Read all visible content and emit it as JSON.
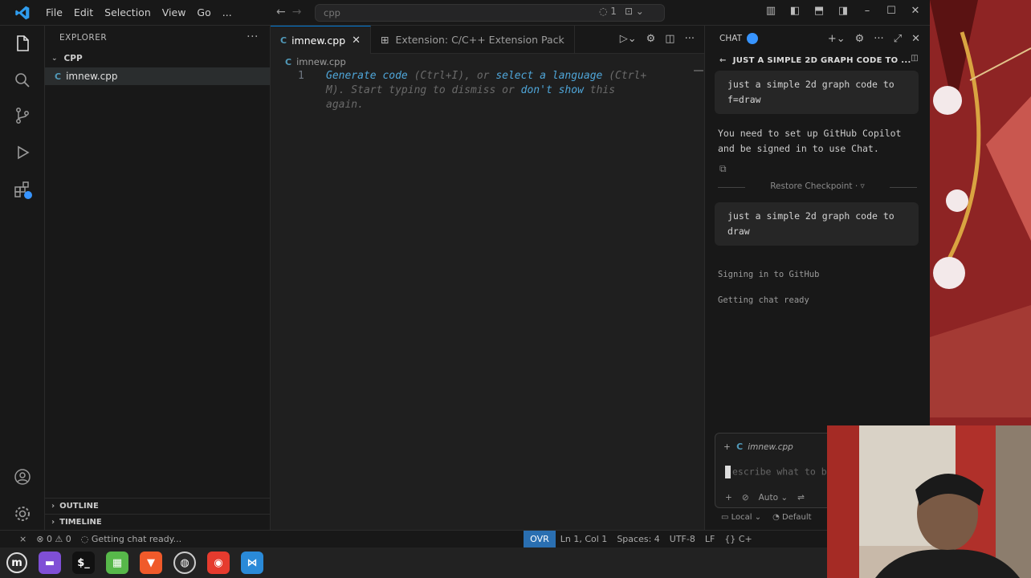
{
  "titlebar": {
    "menu": [
      "File",
      "Edit",
      "Selection",
      "View",
      "Go",
      "..."
    ],
    "search_text": "cpp",
    "copilot_count": "1"
  },
  "sidebar": {
    "header": "EXPLORER",
    "folder": "CPP",
    "file": "imnew.cpp",
    "outline": "OUTLINE",
    "timeline": "TIMELINE"
  },
  "editor": {
    "tabs": [
      {
        "label": "imnew.cpp"
      },
      {
        "label": "Extension: C/C++ Extension Pack"
      }
    ],
    "breadcrumb": "imnew.cpp",
    "line_number": "1",
    "hint": {
      "generate": "Generate code",
      "gen_shortcut": " (Ctrl+I), or ",
      "select_lang": "select a language",
      "lang_shortcut": " (Ctrl+",
      "line2a": "M). Start typing to dismiss or ",
      "dont_show": "don't show",
      "line2b": " this",
      "line3": "again."
    }
  },
  "chat": {
    "header": "CHAT",
    "title": "JUST A SIMPLE 2D GRAPH CODE TO ...",
    "request1": "just a simple 2d graph code to f=draw",
    "response": "You need to set up GitHub Copilot and be signed in to use Chat.",
    "checkpoint": "Restore Checkpoint",
    "request2": "just a simple 2d graph code to draw",
    "signing": "Signing in to GitHub",
    "getting_ready": "Getting chat ready",
    "input_context": "imnew.cpp",
    "input_placeholder": "escribe what to b",
    "mode": "Auto",
    "footer_local": "Local",
    "footer_default": "Default"
  },
  "statusbar": {
    "errors": "0",
    "warnings": "0",
    "message": "Getting chat ready...",
    "ovr": "OVR",
    "position": "Ln 1, Col 1",
    "spaces": "Spaces: 4",
    "encoding": "UTF-8",
    "eol": "LF",
    "lang": "C+"
  },
  "colors": {
    "accent": "#0078d4",
    "link": "#4fa6d9",
    "ovr_bg": "#2a6fb1"
  }
}
